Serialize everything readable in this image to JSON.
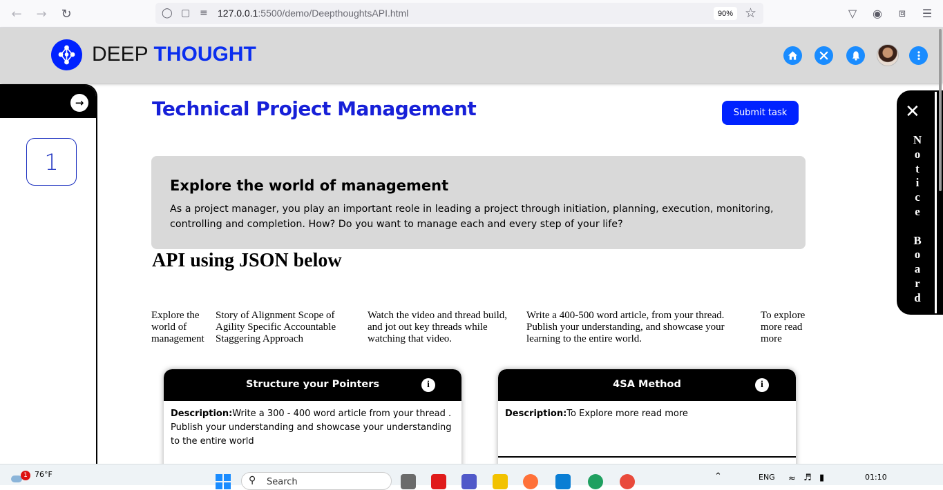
{
  "browser": {
    "url_host": "127.0.0.1",
    "url_rest": ":5500/demo/DeepthoughtsAPI.html",
    "zoom": "90%"
  },
  "header": {
    "logo_word1": "DEEP",
    "logo_word2": "THOUGHT",
    "icons": [
      "home-icon",
      "tools-icon",
      "bell-icon",
      "avatar",
      "more-icon"
    ],
    "accent_color": "#0022ff"
  },
  "sidebar": {
    "toggle_icon": "arrow-right-icon",
    "step_number": "1"
  },
  "main": {
    "title": "Technical Project Management",
    "submit_label": "Submit task",
    "intro": {
      "title": "Explore the world of management",
      "description": "As a project manager, you play an important reole in leading a project through initiation, planning, execution, monitoring, controlling and completion. How? Do you want to manage each and every step of your life?"
    },
    "api_heading": "API using JSON below",
    "api_row": [
      "Explore the world of management",
      "Story of Alignment Scope of Agility Specific Accountable Staggering Approach",
      "Watch the video and thread build, and jot out key threads while watching that video.",
      "Write a 400-500 word article, from your thread. Publish your understanding, and showcase your learning to the entire world.",
      "To explore more read more"
    ],
    "cards": [
      {
        "title": "Structure your Pointers",
        "desc_label": "Description:",
        "desc_text": "Write a 300 - 400 word article from your thread . Publish your understanding and showcase your understanding to the entire world"
      },
      {
        "title": "4SA Method",
        "desc_label": "Description:",
        "desc_text": "To Explore more read more"
      }
    ]
  },
  "notice_board": {
    "close_glyph": "✕",
    "label": "Notice Board"
  },
  "taskbar": {
    "temperature": "76°F",
    "weather_badge": "1",
    "search_placeholder": "Search",
    "language": "ENG",
    "time": "01:10"
  }
}
